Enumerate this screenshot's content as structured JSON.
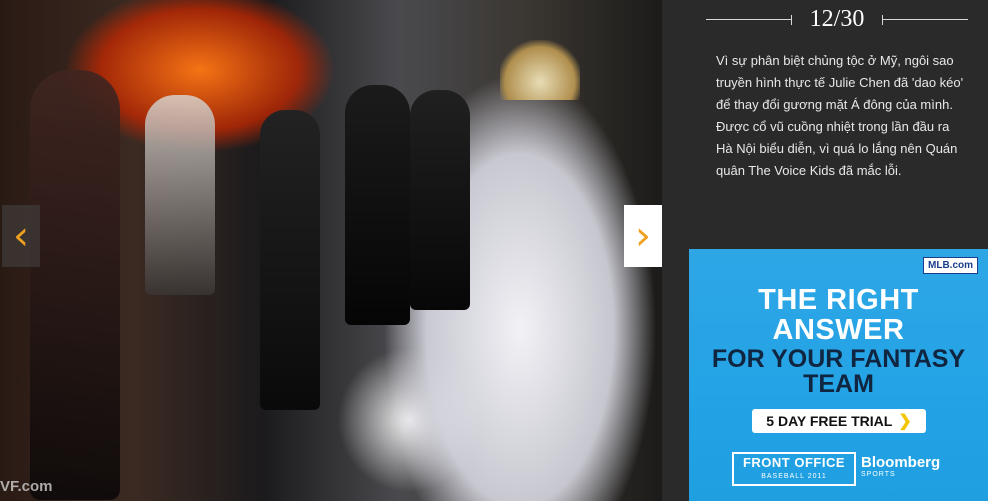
{
  "slideshow": {
    "counter": "12/30",
    "watermark": "VF.com",
    "prev_arrow": "‹",
    "next_arrow": "›",
    "caption": "Vì sự phân biệt chủng tộc ở Mỹ, ngôi sao truyền hình thực tế Julie Chen đã 'dao kéo' để thay đổi gương mặt Á đông của mình. Được cổ vũ cuồng nhiệt trong lần đầu ra Hà Nội biểu diễn, vì quá lo lắng nên Quán quân The Voice Kids đã mắc lỗi."
  },
  "ad": {
    "badge": "MLB.com",
    "headline_top": "THE RIGHT ANSWER",
    "headline_bottom": "FOR YOUR FANTASY TEAM",
    "cta": "5 DAY FREE TRIAL",
    "cta_icon": "chevron-right",
    "logo_front_office": "FRONT OFFICE",
    "logo_front_office_sub": "BASEBALL 2011",
    "logo_bloomberg": "Bloomberg",
    "logo_bloomberg_sub": "SPORTS",
    "colors": {
      "background": "#23a3e6",
      "headline_dark": "#10253f",
      "cta_chevron": "#f3c400"
    }
  },
  "colors": {
    "arrow": "#f0a020",
    "panel_bg": "#2a2a2a"
  }
}
